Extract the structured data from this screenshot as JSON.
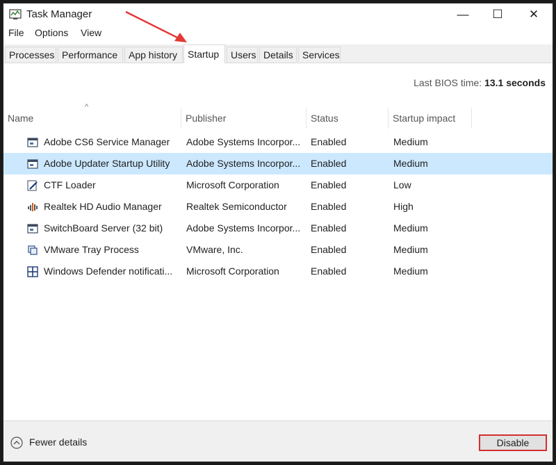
{
  "window": {
    "title": "Task Manager",
    "controls": {
      "minimize": "—",
      "maximize": "☐",
      "close": "✕"
    }
  },
  "menu": [
    "File",
    "Options",
    "View"
  ],
  "tabs": [
    {
      "label": "Processes",
      "active": false
    },
    {
      "label": "Performance",
      "active": false
    },
    {
      "label": "App history",
      "active": false
    },
    {
      "label": "Startup",
      "active": true
    },
    {
      "label": "Users",
      "active": false
    },
    {
      "label": "Details",
      "active": false
    },
    {
      "label": "Services",
      "active": false
    }
  ],
  "bios": {
    "label": "Last BIOS time:",
    "value": "13.1 seconds"
  },
  "table": {
    "columns": [
      "Name",
      "Publisher",
      "Status",
      "Startup impact"
    ],
    "rows": [
      {
        "name": "Adobe CS6 Service Manager",
        "publisher": "Adobe Systems Incorpor...",
        "status": "Enabled",
        "impact": "Medium",
        "icon": "window-icon",
        "selected": false
      },
      {
        "name": "Adobe Updater Startup Utility",
        "publisher": "Adobe Systems Incorpor...",
        "status": "Enabled",
        "impact": "Medium",
        "icon": "window-icon",
        "selected": true
      },
      {
        "name": "CTF Loader",
        "publisher": "Microsoft Corporation",
        "status": "Enabled",
        "impact": "Low",
        "icon": "pen-icon",
        "selected": false
      },
      {
        "name": "Realtek HD Audio Manager",
        "publisher": "Realtek Semiconductor",
        "status": "Enabled",
        "impact": "High",
        "icon": "audio-icon",
        "selected": false
      },
      {
        "name": "SwitchBoard Server (32 bit)",
        "publisher": "Adobe Systems Incorpor...",
        "status": "Enabled",
        "impact": "Medium",
        "icon": "window-icon",
        "selected": false
      },
      {
        "name": "VMware Tray Process",
        "publisher": "VMware, Inc.",
        "status": "Enabled",
        "impact": "Medium",
        "icon": "vmware-icon",
        "selected": false
      },
      {
        "name": "Windows Defender notificati...",
        "publisher": "Microsoft Corporation",
        "status": "Enabled",
        "impact": "Medium",
        "icon": "defender-icon",
        "selected": false
      }
    ]
  },
  "footer": {
    "fewer_details": "Fewer details",
    "disable": "Disable"
  },
  "colors": {
    "selected_row": "#cce8ff",
    "highlight": "#d32f2f"
  }
}
